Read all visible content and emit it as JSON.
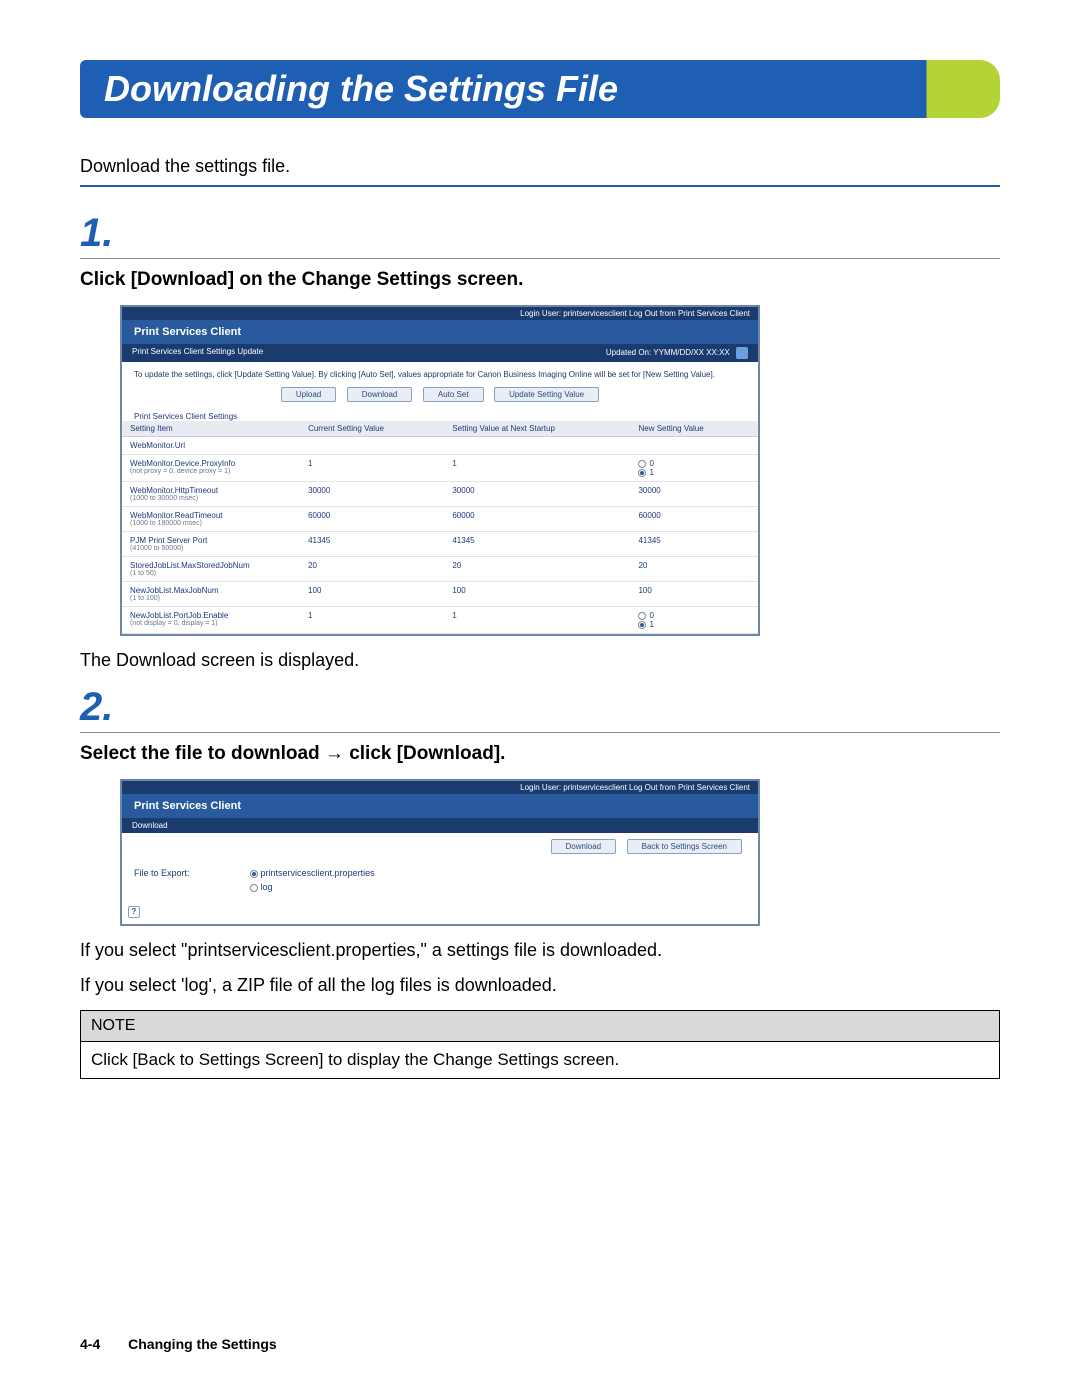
{
  "page_title": "Downloading the Settings File",
  "intro": "Download the settings file.",
  "steps": {
    "one": {
      "num": "1.",
      "title": "Click [Download] on the Change Settings screen.",
      "after": "The Download screen is displayed."
    },
    "two": {
      "num": "2.",
      "title": "Select the file to download → click [Download].",
      "after1": "If you select \"printservicesclient.properties,\" a settings file is downloaded.",
      "after2": "If you select 'log', a ZIP file of all the log files is downloaded."
    }
  },
  "screenshot1": {
    "topbar": "Login User: printservicesclient   Log Out from Print Services Client",
    "header": "Print Services Client",
    "subbar_left": "Print Services Client Settings Update",
    "subbar_right": "Updated On: YYMM/DD/XX XX:XX",
    "note": "To update the settings, click [Update Setting Value]. By clicking [Auto Set], values appropriate for Canon Business Imaging Online will be set for [New Setting Value].",
    "buttons": {
      "upload": "Upload",
      "download": "Download",
      "autoset": "Auto Set",
      "update": "Update Setting Value"
    },
    "section": "Print Services Client Settings",
    "cols": {
      "c1": "Setting Item",
      "c2": "Current Setting Value",
      "c3": "Setting Value at Next Startup",
      "c4": "New Setting Value"
    },
    "rows": [
      {
        "name": "WebMonitor.Url",
        "hint": "",
        "cur": "",
        "next": "",
        "new_kind": "text",
        "new": ""
      },
      {
        "name": "WebMonitor.Device.ProxyInfo",
        "hint": "(not proxy = 0, device proxy = 1)",
        "cur": "1",
        "next": "1",
        "new_kind": "radio",
        "new": "0|1"
      },
      {
        "name": "WebMonitor.HttpTimeout",
        "hint": "(1000 to 30000 msec)",
        "cur": "30000",
        "next": "30000",
        "new_kind": "text",
        "new": "30000"
      },
      {
        "name": "WebMonitor.ReadTimeout",
        "hint": "(1000 to 180000 msec)",
        "cur": "60000",
        "next": "60000",
        "new_kind": "text",
        "new": "60000"
      },
      {
        "name": "PJM Print Server Port",
        "hint": "(41000 to 50000)",
        "cur": "41345",
        "next": "41345",
        "new_kind": "text",
        "new": "41345"
      },
      {
        "name": "StoredJobList.MaxStoredJobNum",
        "hint": "(1 to 50)",
        "cur": "20",
        "next": "20",
        "new_kind": "text",
        "new": "20"
      },
      {
        "name": "NewJobList.MaxJobNum",
        "hint": "(1 to 100)",
        "cur": "100",
        "next": "100",
        "new_kind": "text",
        "new": "100"
      },
      {
        "name": "NewJobList.PortJob.Enable",
        "hint": "(not display = 0, display = 1)",
        "cur": "1",
        "next": "1",
        "new_kind": "radio",
        "new": "0|1"
      }
    ]
  },
  "screenshot2": {
    "topbar": "Login User: printservicesclient   Log Out from Print Services Client",
    "header": "Print Services Client",
    "subheader": "Download",
    "buttons": {
      "download": "Download",
      "back": "Back to Settings Screen"
    },
    "label": "File to Export:",
    "options": {
      "a": "printservicesclient.properties",
      "b": "log"
    }
  },
  "note": {
    "head": "NOTE",
    "body": "Click [Back to Settings Screen] to display the Change Settings screen."
  },
  "footer": {
    "pagenum": "4-4",
    "chapter": "Changing the Settings"
  }
}
